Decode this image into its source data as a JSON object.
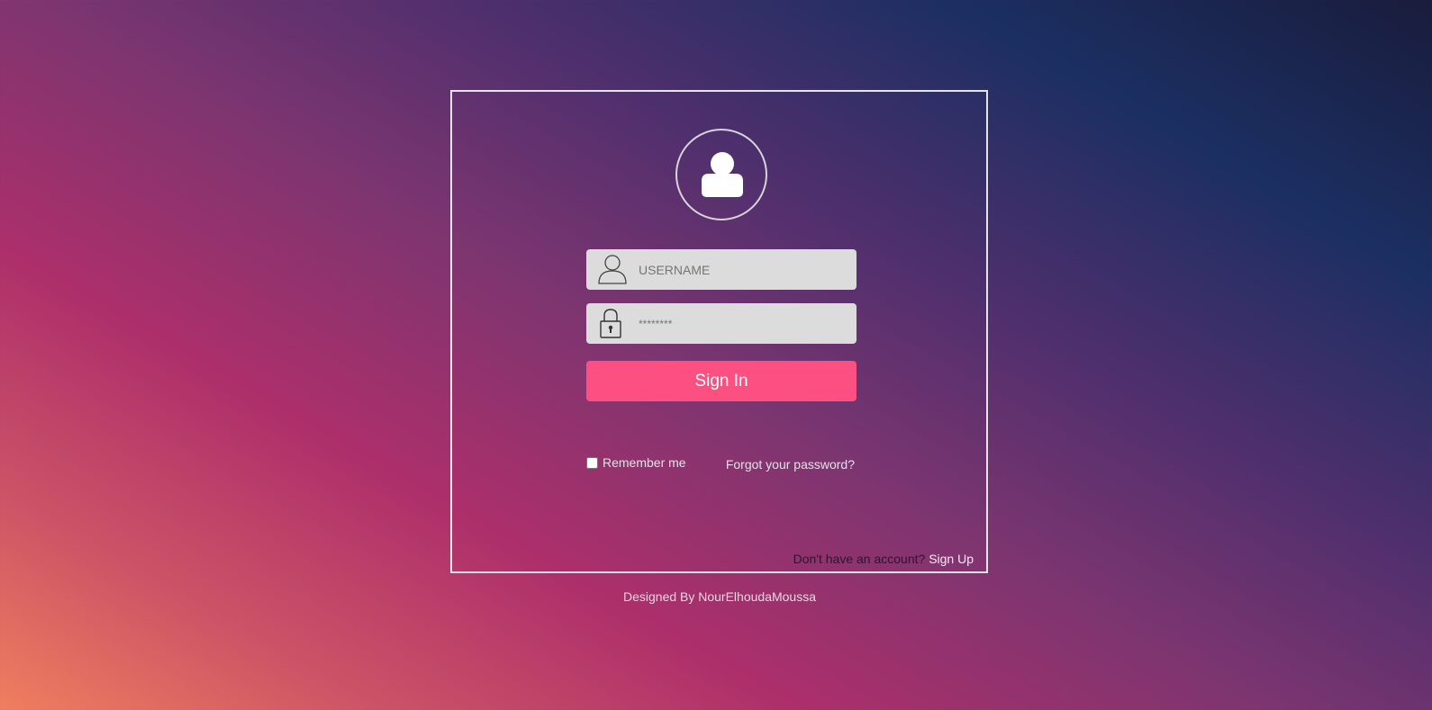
{
  "login": {
    "username_placeholder": "USERNAME",
    "password_placeholder": "********",
    "signin_label": "Sign In",
    "remember_label": "Remember me",
    "forgot_label": "Forgot your password?",
    "no_account_text": "Don't have an account?",
    "signup_label": "Sign Up"
  },
  "icons": {
    "avatar": "user-icon",
    "username": "user-outline-icon",
    "password": "lock-icon"
  },
  "footer": {
    "credit": "Designed By NourElhoudaMoussa"
  },
  "colors": {
    "button": "#fc5083",
    "field_bg": "#dcdcdc",
    "card_border": "#e7e3ea"
  }
}
